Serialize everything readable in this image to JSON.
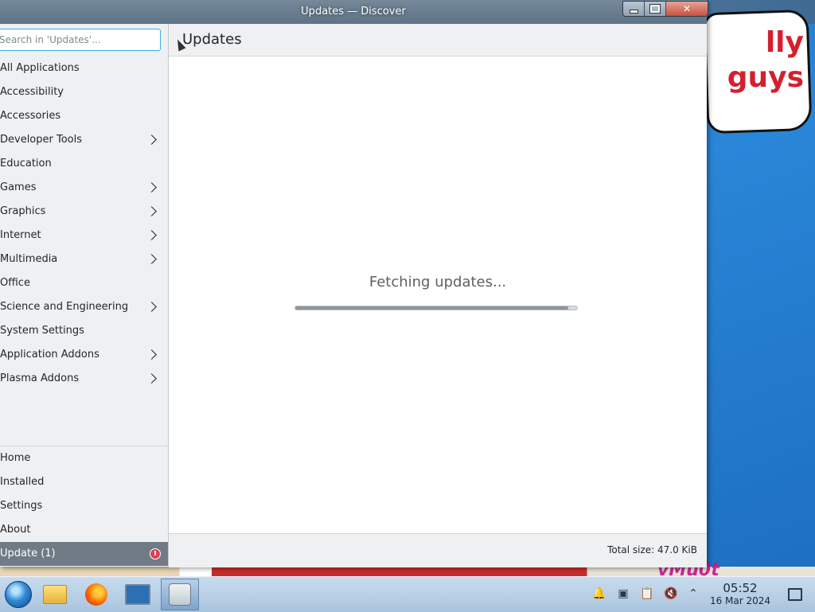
{
  "window": {
    "title": "Updates — Discover"
  },
  "search": {
    "placeholder": "Search in 'Updates'..."
  },
  "sidebar": {
    "categories": [
      {
        "label": "All Applications",
        "has_submenu": false
      },
      {
        "label": "Accessibility",
        "has_submenu": false
      },
      {
        "label": "Accessories",
        "has_submenu": false
      },
      {
        "label": "Developer Tools",
        "has_submenu": true
      },
      {
        "label": "Education",
        "has_submenu": false
      },
      {
        "label": "Games",
        "has_submenu": true
      },
      {
        "label": "Graphics",
        "has_submenu": true
      },
      {
        "label": "Internet",
        "has_submenu": true
      },
      {
        "label": "Multimedia",
        "has_submenu": true
      },
      {
        "label": "Office",
        "has_submenu": false
      },
      {
        "label": "Science and Engineering",
        "has_submenu": true
      },
      {
        "label": "System Settings",
        "has_submenu": false
      },
      {
        "label": "Application Addons",
        "has_submenu": true
      },
      {
        "label": "Plasma Addons",
        "has_submenu": true
      }
    ],
    "bottom": [
      {
        "label": "Home"
      },
      {
        "label": "Installed"
      },
      {
        "label": "Settings"
      },
      {
        "label": "About"
      }
    ],
    "update_item": {
      "label": "Update (1)",
      "selected": true
    }
  },
  "main": {
    "title": "Updates",
    "status": "Fetching updates...",
    "progress": 0.97,
    "total_size": "Total size: 47.0 KiB"
  },
  "wallpaper": {
    "bubble_text_line1": "lly",
    "bubble_text_line2": "guys",
    "watermark": "vMu0t"
  },
  "taskbar": {
    "apps": [
      "start-menu-icon",
      "file-manager-icon",
      "firefox-icon",
      "system-monitor-icon",
      "discover-icon"
    ],
    "clock_time": "05:52",
    "clock_date": "16 Mar 2024"
  },
  "colors": {
    "accent": "#3daee9",
    "selected_bg": "#707b86",
    "badge": "#da4453"
  }
}
